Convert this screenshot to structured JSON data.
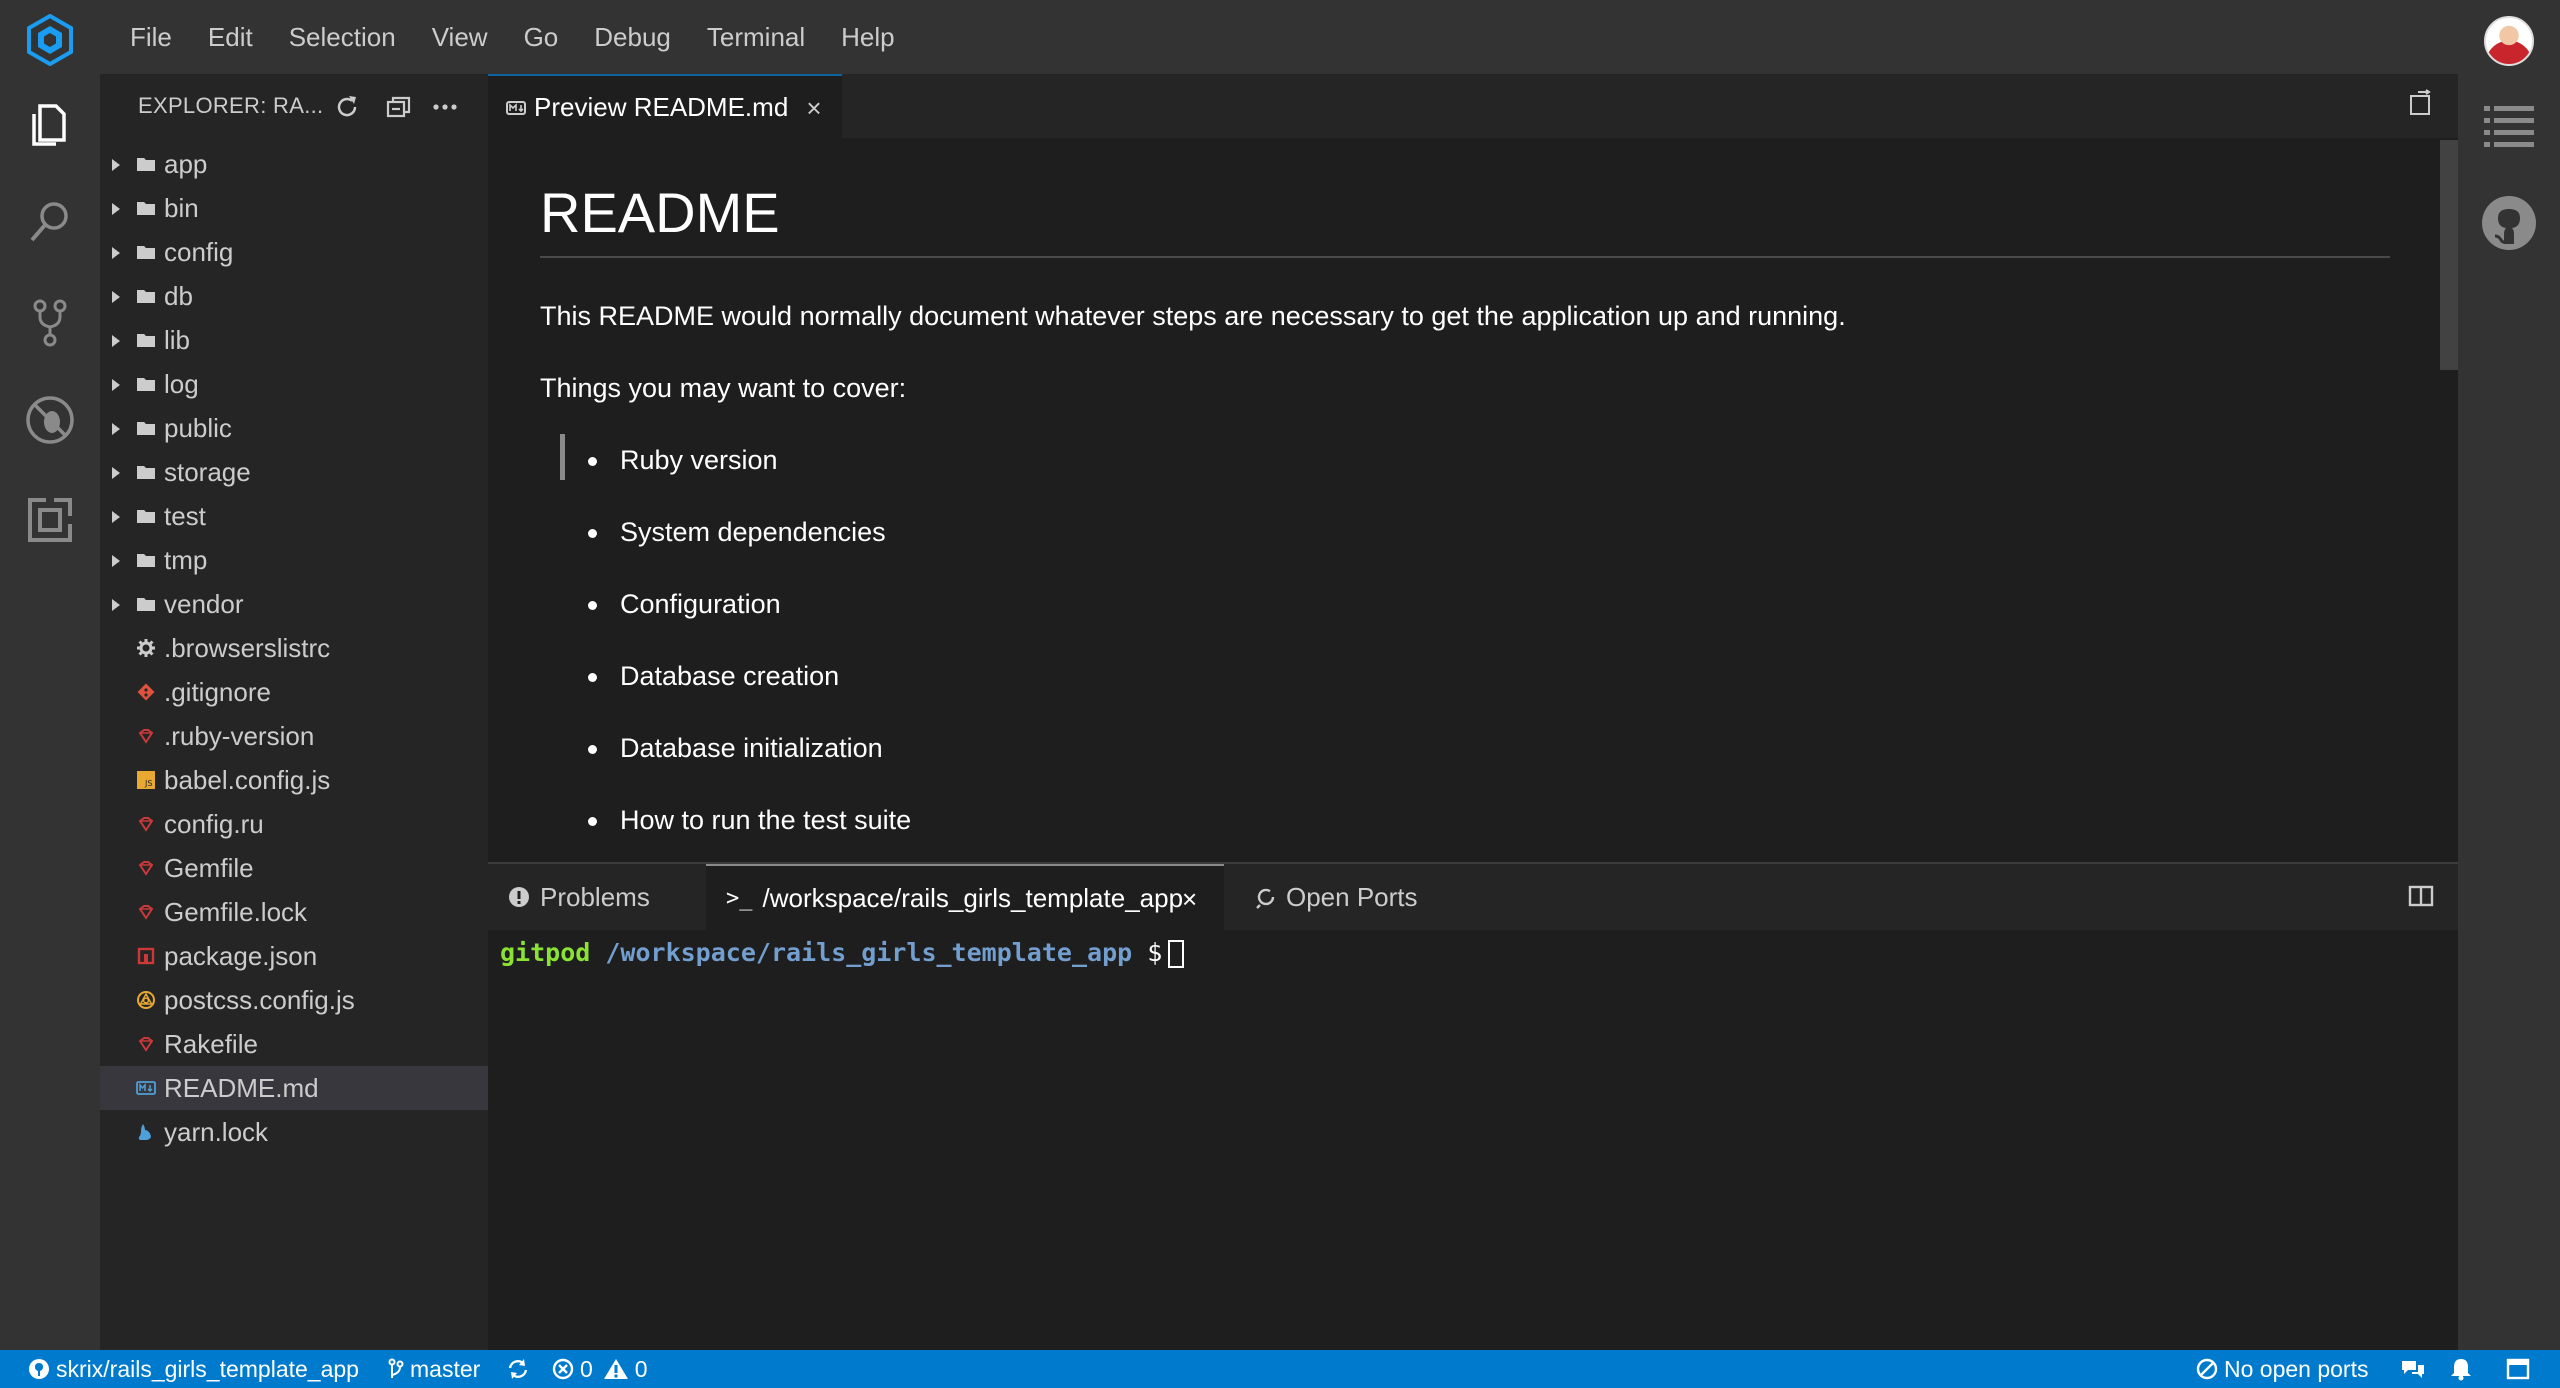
{
  "menubar": {
    "items": [
      "File",
      "Edit",
      "Selection",
      "View",
      "Go",
      "Debug",
      "Terminal",
      "Help"
    ]
  },
  "sidebar": {
    "title": "EXPLORER: RA...",
    "folders": [
      "app",
      "bin",
      "config",
      "db",
      "lib",
      "log",
      "public",
      "storage",
      "test",
      "tmp",
      "vendor"
    ],
    "files": [
      {
        "name": ".browserslistrc",
        "icon": "gear-icon",
        "color": "#cccccc"
      },
      {
        "name": ".gitignore",
        "icon": "git-icon",
        "color": "#e0523e"
      },
      {
        "name": ".ruby-version",
        "icon": "ruby-icon",
        "color": "#c9383a"
      },
      {
        "name": "babel.config.js",
        "icon": "js-icon",
        "color": "#e8a832"
      },
      {
        "name": "config.ru",
        "icon": "ruby-icon",
        "color": "#c9383a"
      },
      {
        "name": "Gemfile",
        "icon": "ruby-icon",
        "color": "#c9383a"
      },
      {
        "name": "Gemfile.lock",
        "icon": "ruby-icon",
        "color": "#c9383a"
      },
      {
        "name": "package.json",
        "icon": "npm-icon",
        "color": "#cb3837"
      },
      {
        "name": "postcss.config.js",
        "icon": "postcss-icon",
        "color": "#e8a832"
      },
      {
        "name": "Rakefile",
        "icon": "ruby-icon",
        "color": "#c9383a"
      },
      {
        "name": "README.md",
        "icon": "markdown-icon",
        "color": "#4f9fd8"
      },
      {
        "name": "yarn.lock",
        "icon": "yarn-icon",
        "color": "#4f9fd8"
      }
    ],
    "selected": "README.md"
  },
  "editor": {
    "tab_label": "Preview README.md",
    "close_glyph": "×",
    "heading": "README",
    "intro": "This README would normally document whatever steps are necessary to get the application up and running.",
    "list_intro": "Things you may want to cover:",
    "list_items": [
      "Ruby version",
      "System dependencies",
      "Configuration",
      "Database creation",
      "Database initialization",
      "How to run the test suite"
    ]
  },
  "panel": {
    "tab_problems": "Problems",
    "tab_terminal": "/workspace/rails_girls_template_app",
    "tab_ports": "Open Ports",
    "close_glyph": "×",
    "terminal": {
      "user": "gitpod",
      "path": "/workspace/rails_girls_template_app",
      "prompt": "$"
    }
  },
  "statusbar": {
    "repo": "skrix/rails_girls_template_app",
    "branch": "master",
    "errors": "0",
    "warnings": "0",
    "ports": "No open ports"
  },
  "colors": {
    "accent": "#007acc",
    "terminal_user": "#8ae234",
    "terminal_path": "#729fcf"
  }
}
